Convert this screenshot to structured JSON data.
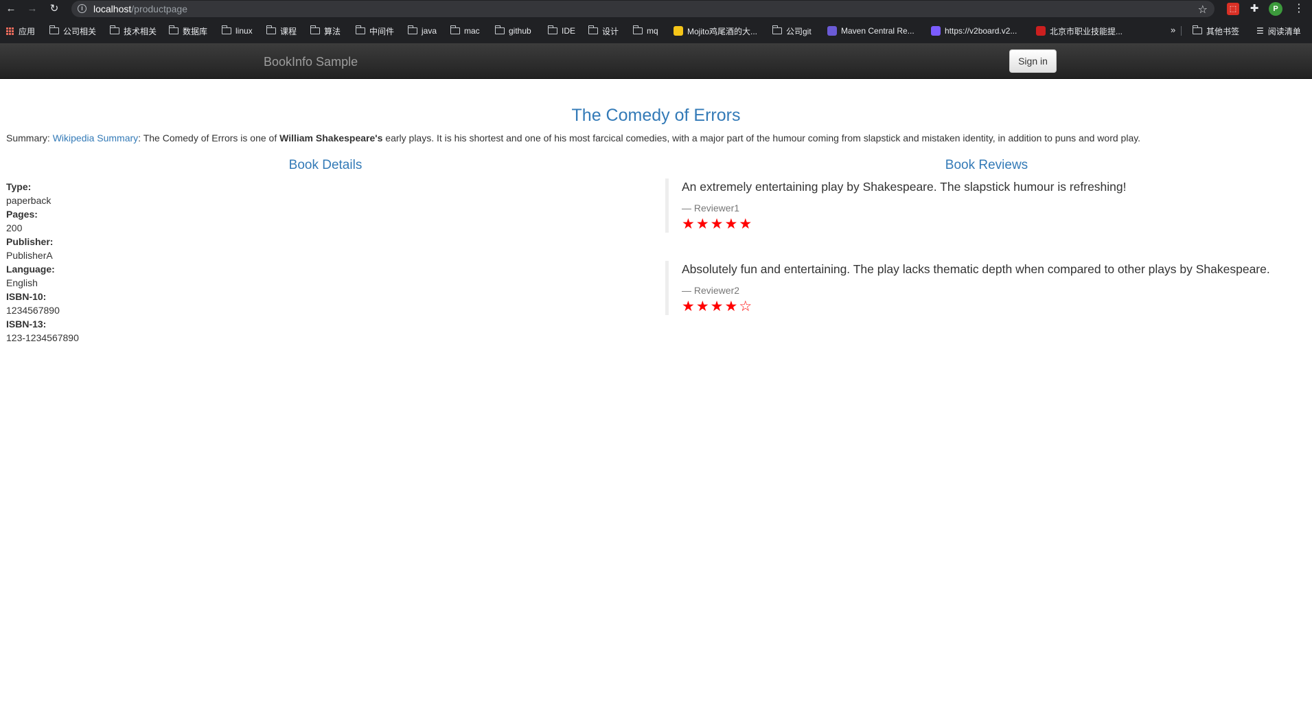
{
  "browser": {
    "url_host": "localhost",
    "url_path": "/productpage",
    "profile_initial": "P",
    "bookmarks": [
      {
        "label": "应用",
        "type": "apps"
      },
      {
        "label": "公司相关",
        "type": "folder"
      },
      {
        "label": "技术相关",
        "type": "folder"
      },
      {
        "label": "数据库",
        "type": "folder"
      },
      {
        "label": "linux",
        "type": "folder"
      },
      {
        "label": "课程",
        "type": "folder"
      },
      {
        "label": "算法",
        "type": "folder"
      },
      {
        "label": "中间件",
        "type": "folder"
      },
      {
        "label": "java",
        "type": "folder"
      },
      {
        "label": "mac",
        "type": "folder"
      },
      {
        "label": "github",
        "type": "folder"
      },
      {
        "label": "IDE",
        "type": "folder"
      },
      {
        "label": "设计",
        "type": "folder"
      },
      {
        "label": "mq",
        "type": "folder"
      },
      {
        "label": "Mojito鸡尾酒的大...",
        "type": "site",
        "color": "#f5c518"
      },
      {
        "label": "公司git",
        "type": "folder"
      },
      {
        "label": "Maven Central Re...",
        "type": "site",
        "color": "#6b5bd6"
      },
      {
        "label": "https://v2board.v2...",
        "type": "site",
        "color": "#7b5cff"
      },
      {
        "label": "北京市职业技能提...",
        "type": "site",
        "color": "#cc1f1f"
      }
    ],
    "overflow_label": "»",
    "other_bookmarks": "其他书签",
    "reading_list": "阅读清单"
  },
  "navbar": {
    "brand": "BookInfo Sample",
    "signin_label": "Sign in"
  },
  "book": {
    "title": "The Comedy of Errors",
    "summary_prefix": "Summary: ",
    "summary_link": "Wikipedia Summary",
    "summary_mid": ": The Comedy of Errors is one of ",
    "summary_bold": "William Shakespeare's",
    "summary_rest": " early plays. It is his shortest and one of his most farcical comedies, with a major part of the humour coming from slapstick and mistaken identity, in addition to puns and word play."
  },
  "details": {
    "heading": "Book Details",
    "fields": [
      {
        "label": "Type:",
        "value": "paperback"
      },
      {
        "label": "Pages:",
        "value": "200"
      },
      {
        "label": "Publisher:",
        "value": "PublisherA"
      },
      {
        "label": "Language:",
        "value": "English"
      },
      {
        "label": "ISBN-10:",
        "value": "1234567890"
      },
      {
        "label": "ISBN-13:",
        "value": "123-1234567890"
      }
    ]
  },
  "reviews": {
    "heading": "Book Reviews",
    "items": [
      {
        "text": "An extremely entertaining play by Shakespeare. The slapstick humour is refreshing!",
        "reviewer": "— Reviewer1",
        "rating": 5,
        "max": 5,
        "star_color": "#ff0000"
      },
      {
        "text": "Absolutely fun and entertaining. The play lacks thematic depth when compared to other plays by Shakespeare.",
        "reviewer": "— Reviewer2",
        "rating": 4,
        "max": 5,
        "star_color": "#ff0000"
      }
    ]
  }
}
